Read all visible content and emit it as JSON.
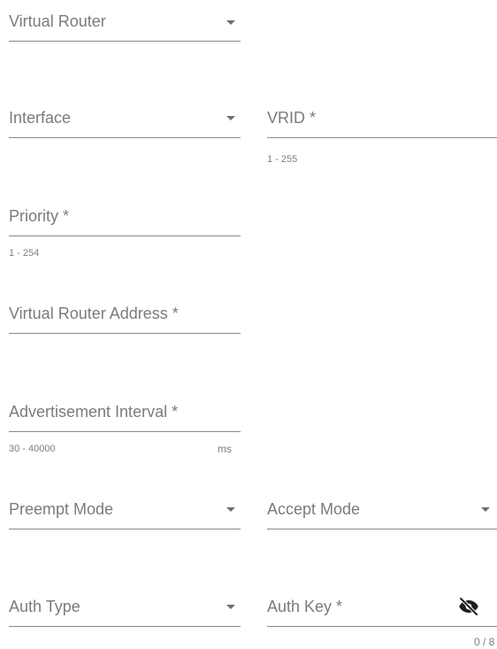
{
  "form": {
    "virtual_router": {
      "label": "Virtual Router",
      "icon": "chevron-down-icon"
    },
    "interface": {
      "label": "Interface",
      "icon": "chevron-down-icon"
    },
    "vrid": {
      "label": "VRID *",
      "hint": "1 - 255"
    },
    "priority": {
      "label": "Priority *",
      "hint": "1 - 254"
    },
    "virtual_router_address": {
      "label": "Virtual Router Address *"
    },
    "advertisement_interval": {
      "label": "Advertisement Interval *",
      "hint": "30 - 40000",
      "suffix": "ms"
    },
    "preempt_mode": {
      "label": "Preempt Mode",
      "icon": "chevron-down-icon"
    },
    "accept_mode": {
      "label": "Accept Mode",
      "icon": "chevron-down-icon"
    },
    "auth_type": {
      "label": "Auth Type",
      "icon": "chevron-down-icon"
    },
    "auth_key": {
      "label": "Auth Key *",
      "counter": "0 / 8",
      "icon": "eye-off-icon"
    }
  }
}
